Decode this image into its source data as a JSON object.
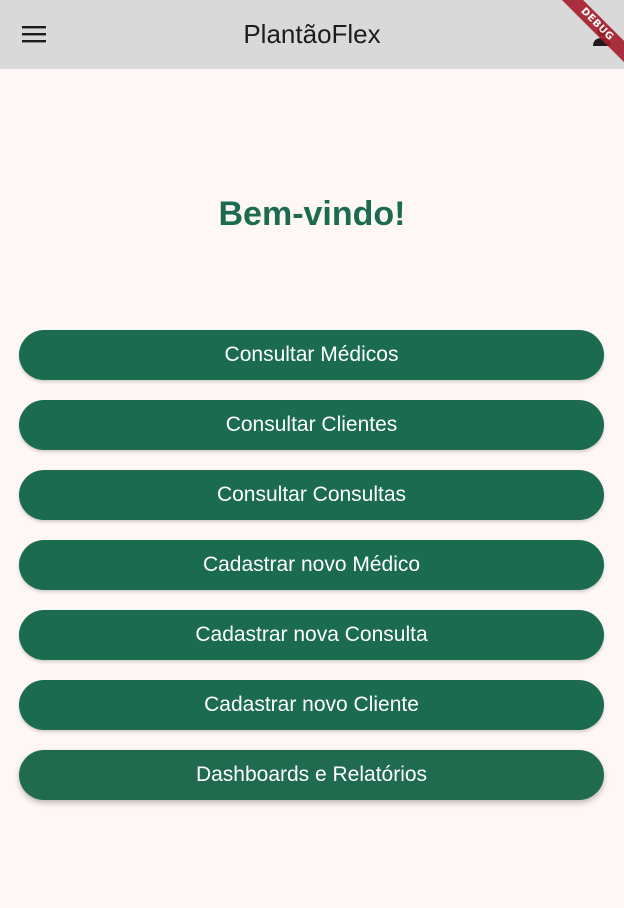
{
  "app_bar": {
    "title": "PlantãoFlex",
    "menu_icon": "hamburger-menu-icon",
    "account_icon": "person-icon",
    "background": "#d9d9d9"
  },
  "debug_banner": {
    "label": "DEBUG",
    "color": "#a31d2a"
  },
  "main": {
    "welcome": "Bem-vindo!",
    "accent_color": "#1a6b4f",
    "buttons": [
      {
        "label": "Consultar Médicos"
      },
      {
        "label": "Consultar Clientes"
      },
      {
        "label": "Consultar Consultas"
      },
      {
        "label": "Cadastrar novo Médico"
      },
      {
        "label": "Cadastrar nova Consulta"
      },
      {
        "label": "Cadastrar novo Cliente"
      },
      {
        "label": "Dashboards e Relatórios"
      }
    ]
  }
}
